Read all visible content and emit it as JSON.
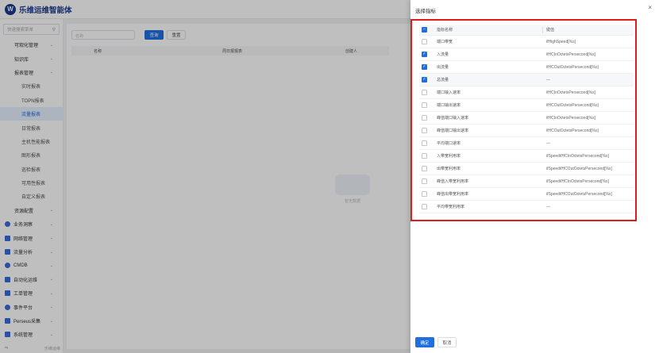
{
  "header": {
    "logo_letter": "W",
    "title": "乐维运维智能体"
  },
  "sidebar": {
    "search_placeholder": "快速搜索菜单",
    "items": [
      {
        "label": "可观化管理",
        "level": "l2",
        "chev": "⌄"
      },
      {
        "label": "知识库",
        "level": "l2",
        "chev": "⌄"
      },
      {
        "label": "报表管理",
        "level": "l2",
        "chev": "⌄"
      },
      {
        "label": "实时报表",
        "level": "l3"
      },
      {
        "label": "TOPN报表",
        "level": "l3"
      },
      {
        "label": "流量报表",
        "level": "l3",
        "active": true
      },
      {
        "label": "日常报表",
        "level": "l3"
      },
      {
        "label": "主机性能报表",
        "level": "l3"
      },
      {
        "label": "图形报表",
        "level": "l3"
      },
      {
        "label": "巡检报表",
        "level": "l3"
      },
      {
        "label": "可用性报表",
        "level": "l3"
      },
      {
        "label": "自定义报表",
        "level": "l3"
      },
      {
        "label": "资源配置",
        "level": "l2",
        "chev": "⌄"
      },
      {
        "label": "业务洞察",
        "level": "l1",
        "chev": "⌄",
        "icon": true
      },
      {
        "label": "网络管理",
        "level": "l1",
        "chev": "⌄",
        "icon": true
      },
      {
        "label": "流量分析",
        "level": "l1",
        "chev": "⌄",
        "icon": true
      },
      {
        "label": "CMDB",
        "level": "l1",
        "chev": "⌄",
        "icon": true
      },
      {
        "label": "自动化运维",
        "level": "l1",
        "chev": "⌄",
        "icon": true
      },
      {
        "label": "工单管理",
        "level": "l1",
        "chev": "⌄",
        "icon": true
      },
      {
        "label": "事件平台",
        "level": "l1",
        "chev": "⌄",
        "icon": true
      },
      {
        "label": "Perseus采集",
        "level": "l1",
        "chev": "⌄",
        "icon": true
      },
      {
        "label": "系统管理",
        "level": "l1",
        "chev": "⌄",
        "icon": true
      }
    ],
    "footer_left": "⇆",
    "footer_right": "乐维运维"
  },
  "content": {
    "input_placeholder": "名称",
    "search_label": "查询",
    "reset_label": "重置",
    "columns": [
      "名称",
      "周日报报表",
      "创建人"
    ],
    "empty_text": "暂无数据"
  },
  "drawer": {
    "title": "选择指标",
    "close_glyph": "×",
    "header": {
      "name": "指标名称",
      "value": "键值"
    },
    "rows": [
      {
        "name": "端口带宽",
        "value": "ifHighSpeed[%s]",
        "checked": false
      },
      {
        "name": "入流量",
        "value": "ifHCInOctetsPersecond[%s]",
        "checked": true
      },
      {
        "name": "出流量",
        "value": "ifHCOutOctetsPersecond[%s]",
        "checked": true
      },
      {
        "name": "总流量",
        "value": "—",
        "checked": true,
        "highlight": true
      },
      {
        "name": "端口输入速率",
        "value": "ifHCInOctetsPersecond[%s]",
        "checked": false
      },
      {
        "name": "端口输出速率",
        "value": "ifHCOutOctetsPersecond[%s]",
        "checked": false
      },
      {
        "name": "峰值端口输入速率",
        "value": "ifHCInOctetsPersecond[%s]",
        "checked": false
      },
      {
        "name": "峰值端口输出速率",
        "value": "ifHCOutOctetsPersecond[%s]",
        "checked": false
      },
      {
        "name": "平均端口速率",
        "value": "—",
        "checked": false
      },
      {
        "name": "入带宽利用率",
        "value": "ifSpeedifHCInOctetsPersecond[%s]",
        "checked": false
      },
      {
        "name": "出带宽利用率",
        "value": "ifSpeedifHCOutOctetsPersecond[%s]",
        "checked": false
      },
      {
        "name": "峰值入带宽利用率",
        "value": "ifSpeedifHCInOctetsPersecond[%s]",
        "checked": false
      },
      {
        "name": "峰值出带宽利用率",
        "value": "ifSpeedifHCOutOctetsPersecond[%s]",
        "checked": false
      },
      {
        "name": "平均带宽利用率",
        "value": "—",
        "checked": false
      }
    ],
    "ok_label": "确定",
    "cancel_label": "取消"
  },
  "colors": {
    "accent": "#1f6fe0",
    "highlight_border": "#e01b1b",
    "brand": "#1a3a8f"
  }
}
